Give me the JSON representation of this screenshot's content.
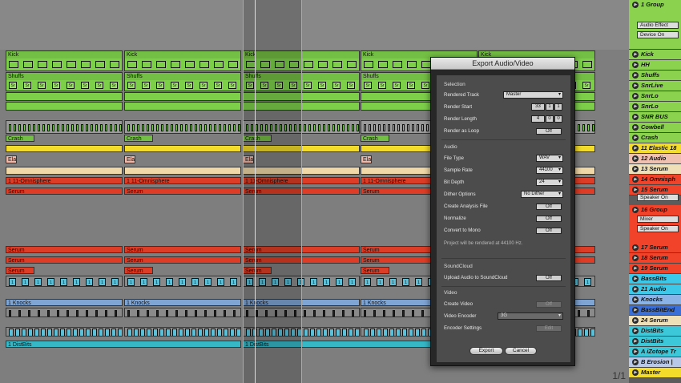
{
  "arrangement": {
    "pager": "1/1",
    "clips": {
      "kick": "Kick",
      "shuffs": "Shuffs",
      "crash": "Crash",
      "elas": "Elas",
      "omni": "1 11-Omnisphere",
      "serum": "Serum",
      "serum_short": "Se",
      "serum_tail": "rum",
      "knocks": "1 Knocks",
      "distbits": "1 DistBits",
      "s_glyph": "Sr",
      "one_glyph": "1"
    }
  },
  "tracks": {
    "group1": "1 Group",
    "audio_effect": "Audio Effect",
    "device_on": "Device On",
    "list_a": [
      "Kick",
      "HH",
      "Shuffs",
      "SnrLive",
      "SnrLo",
      "SnrLo",
      "SNR BUS",
      "Cowbell",
      "Crash"
    ],
    "list_b": [
      "11 Elastic 18",
      "12 Audio",
      "13 Serum",
      "14 Omnisph",
      "15 Serum"
    ],
    "speaker_on": "Speaker On",
    "group16": "16 Group",
    "mixer": "Mixer",
    "speaker_on2": "Speaker On",
    "list_c": [
      "17 Serum",
      "18 Serum",
      "19 Serum"
    ],
    "list_d": [
      "BassBits",
      "21 Audio",
      "Knocks",
      "BassBitEnd",
      "24 Serum",
      "DistBits",
      "DistBits",
      "A iZotope Tr",
      "B Erosion |",
      "Master"
    ]
  },
  "dialog": {
    "title": "Export Audio/Video",
    "selection": "Selection",
    "rendered_track_label": "Rendered Track",
    "rendered_track": "Master",
    "render_start_label": "Render Start",
    "render_start": [
      "33",
      "1",
      "1"
    ],
    "render_length_label": "Render Length",
    "render_length": [
      "4",
      "0",
      "0"
    ],
    "render_loop_label": "Render as Loop",
    "render_loop": "Off",
    "audio": "Audio",
    "file_type_label": "File Type",
    "file_type": "WAV",
    "sample_rate_label": "Sample Rate",
    "sample_rate": "44100",
    "bit_depth_label": "Bit Depth",
    "bit_depth": "24",
    "dither_label": "Dither Options",
    "dither": "No Dither",
    "analysis_label": "Create Analysis File",
    "analysis": "Off",
    "normalize_label": "Normalize",
    "normalize": "Off",
    "mono_label": "Convert to Mono",
    "mono": "Off",
    "rate_note": "Project will be rendered at 44100 Hz.",
    "soundcloud": "SoundCloud",
    "upload_label": "Upload Audio to SoundCloud",
    "upload": "Off",
    "video": "Video",
    "create_video_label": "Create Video",
    "create_video": "Off",
    "encoder_label": "Video Encoder",
    "encoder": "3G",
    "encoder_settings_label": "Encoder Settings",
    "encoder_settings": "Edit",
    "export": "Export",
    "cancel": "Cancel"
  },
  "colors": {
    "green": "#7dcf4a",
    "cyan": "#6ad0e0",
    "yellow": "#f3dc2a",
    "beige": "#f0d8a8",
    "salmon": "#f2b8a8",
    "red": "#f0432a",
    "blue": "#8ab4e8",
    "teal": "#3cc8d8"
  }
}
